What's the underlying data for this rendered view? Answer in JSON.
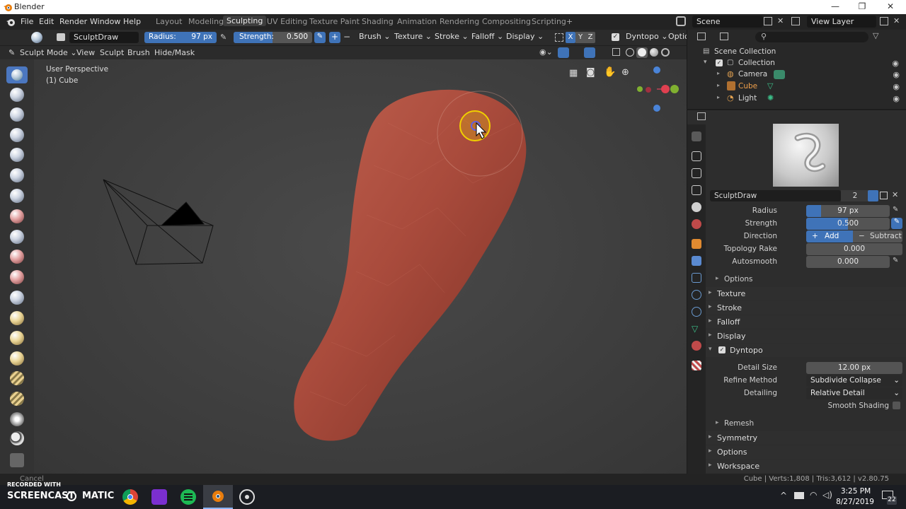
{
  "window": {
    "title": "Blender"
  },
  "menu": [
    "File",
    "Edit",
    "Render",
    "Window",
    "Help"
  ],
  "workspaces": [
    "Layout",
    "Modeling",
    "Sculpting",
    "UV Editing",
    "Texture Paint",
    "Shading",
    "Animation",
    "Rendering",
    "Compositing",
    "Scripting"
  ],
  "workspace_add": "+",
  "scene": {
    "name": "Scene",
    "view_layer": "View Layer"
  },
  "tool_header": {
    "brush_name": "SculptDraw",
    "radius_label": "Radius:",
    "radius_value": "97 px",
    "strength_label": "Strength:",
    "strength_value": "0.500",
    "plus": "+",
    "minus": "−",
    "brush_menu": "Brush",
    "texture_menu": "Texture",
    "stroke_menu": "Stroke",
    "falloff_menu": "Falloff",
    "display_menu": "Display",
    "axes": [
      "X",
      "Y",
      "Z"
    ],
    "dyntopo": "Dyntopo",
    "options": "Optio"
  },
  "mode_header": {
    "mode": "Sculpt Mode",
    "menus": [
      "View",
      "Sculpt",
      "Brush",
      "Hide/Mask"
    ]
  },
  "viewport": {
    "perspective": "User Perspective",
    "object": "(1) Cube"
  },
  "outliner": {
    "root": "Scene Collection",
    "collection": "Collection",
    "items": [
      {
        "name": "Camera",
        "active": false
      },
      {
        "name": "Cube",
        "active": true
      },
      {
        "name": "Light",
        "active": false
      }
    ]
  },
  "properties": {
    "brush_name": "SculptDraw",
    "brush_users": "2",
    "radius_label": "Radius",
    "radius_value": "97 px",
    "strength_label": "Strength",
    "strength_value": "0.500",
    "direction_label": "Direction",
    "direction_add": "Add",
    "direction_subtract": "Subtract",
    "topology_label": "Topology Rake",
    "topology_value": "0.000",
    "autosmooth_label": "Autosmooth",
    "autosmooth_value": "0.000",
    "options_sub": "Options",
    "sections": [
      "Texture",
      "Stroke",
      "Falloff",
      "Display"
    ],
    "dyntopo": "Dyntopo",
    "detail_size_label": "Detail Size",
    "detail_size_value": "12.00 px",
    "refine_label": "Refine Method",
    "refine_value": "Subdivide Collapse",
    "detailing_label": "Detailing",
    "detailing_value": "Relative Detail",
    "smooth_shading": "Smooth Shading",
    "remesh_sub": "Remesh",
    "bottom_sections": [
      "Symmetry",
      "Options",
      "Workspace"
    ]
  },
  "status": {
    "left": "Cancel",
    "right": "Cube | Verts:1,808 | Tris:3,612 | v2.80.75"
  },
  "taskbar": {
    "watermark_top": "RECORDED WITH",
    "watermark": "SCREENCAST",
    "watermark2": "MATIC",
    "time": "3:25 PM",
    "date": "8/27/2019",
    "notifications": "22"
  },
  "colors": {
    "accent_blue": "#4b77c0",
    "active_object": "#f0a04b",
    "mesh": "#b04a3a"
  }
}
